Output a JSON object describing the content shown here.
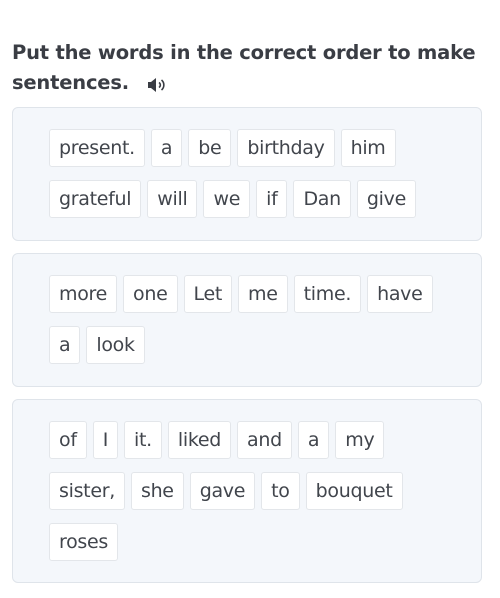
{
  "instruction": "Put the words in the correct order to make sentences.",
  "audio_icon": "speaker-icon",
  "exercises": [
    {
      "rows": [
        [
          "present.",
          "a",
          "be",
          "birthday",
          "him"
        ],
        [
          "grateful",
          "will",
          "we",
          "if",
          "Dan",
          "give"
        ]
      ]
    },
    {
      "rows": [
        [
          "more",
          "one",
          "Let",
          "me",
          "time.",
          "have"
        ],
        [
          "a",
          "look"
        ]
      ]
    },
    {
      "rows": [
        [
          "of",
          "I",
          "it.",
          "liked",
          "and",
          "a",
          "my"
        ],
        [
          "sister,",
          "she",
          "gave",
          "to",
          "bouquet"
        ],
        [
          "roses"
        ]
      ]
    }
  ]
}
